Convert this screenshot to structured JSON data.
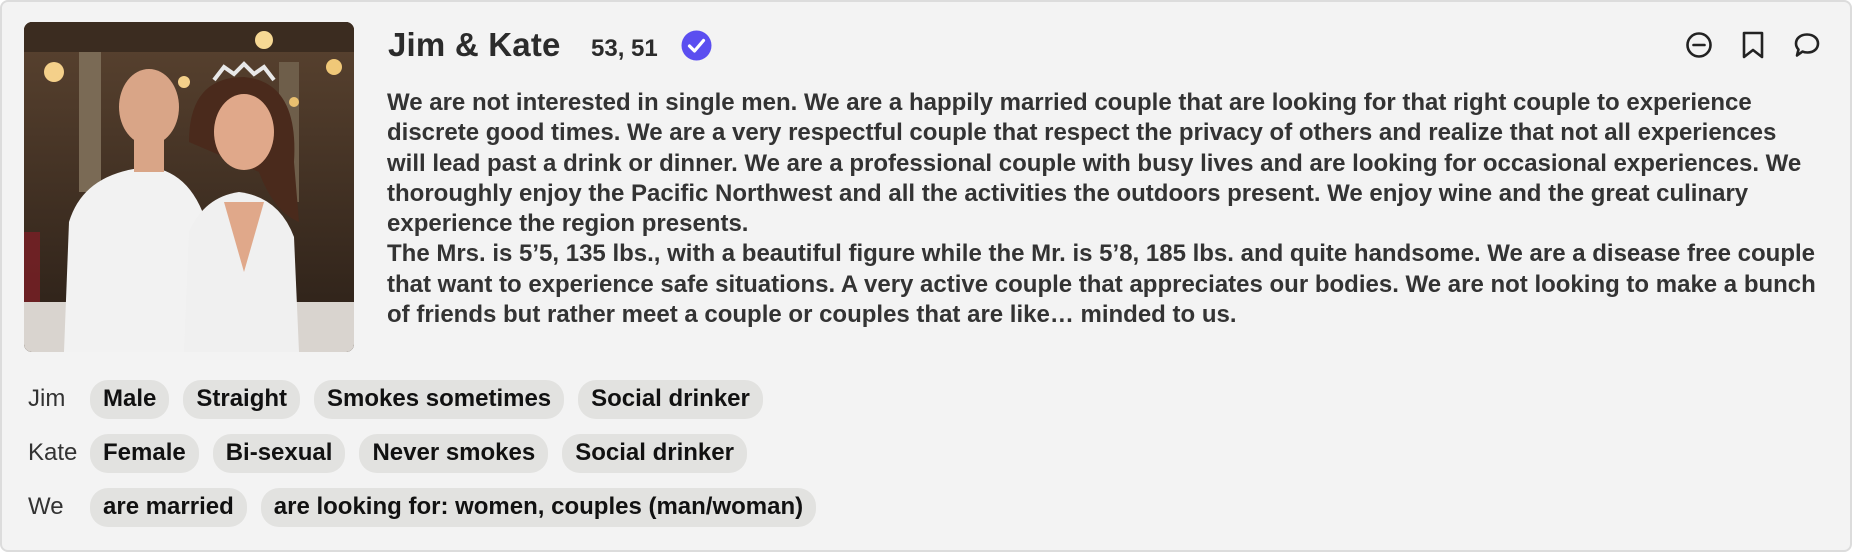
{
  "profile": {
    "name": "Jim & Kate",
    "ages": "53, 51",
    "photo_alt": "Jim & Kate",
    "bio": [
      "We are not interested in single men. We are a happily married couple that are looking for that right couple to experience discrete good times. We are a very respectful couple that respect the privacy of others and realize that not all experiences will lead past a drink or dinner. We are a professional couple with busy lives and are looking for occasional experiences. We thoroughly enjoy the Pacific Northwest and all the activities the outdoors present. We enjoy wine and the great culinary experience the region presents.",
      "The Mrs. is 5’5, 135 lbs., with a beautiful figure while the Mr. is 5’8, 185 lbs. and quite handsome. We are a disease free couple that want to experience safe situations. A very active couple that appreciates our bodies. We are not looking to make a bunch of friends but rather meet a couple or couples that are like… minded to us."
    ]
  },
  "actions": {
    "icons": [
      "minus-circle-icon",
      "bookmark-icon",
      "chat-bubble-icon"
    ]
  },
  "traits": [
    {
      "label": "Jim",
      "tags": [
        "Male",
        "Straight",
        "Smokes sometimes",
        "Social drinker"
      ]
    },
    {
      "label": "Kate",
      "tags": [
        "Female",
        "Bi-sexual",
        "Never smokes",
        "Social drinker"
      ]
    },
    {
      "label": "We",
      "tags": [
        "are married",
        "are looking for: women, couples (man/woman)"
      ]
    }
  ],
  "colors": {
    "card_bg": "#f3f3f3",
    "tag_bg": "#e2e2e0",
    "verified": "#5b4ef0",
    "text": "#333333"
  }
}
